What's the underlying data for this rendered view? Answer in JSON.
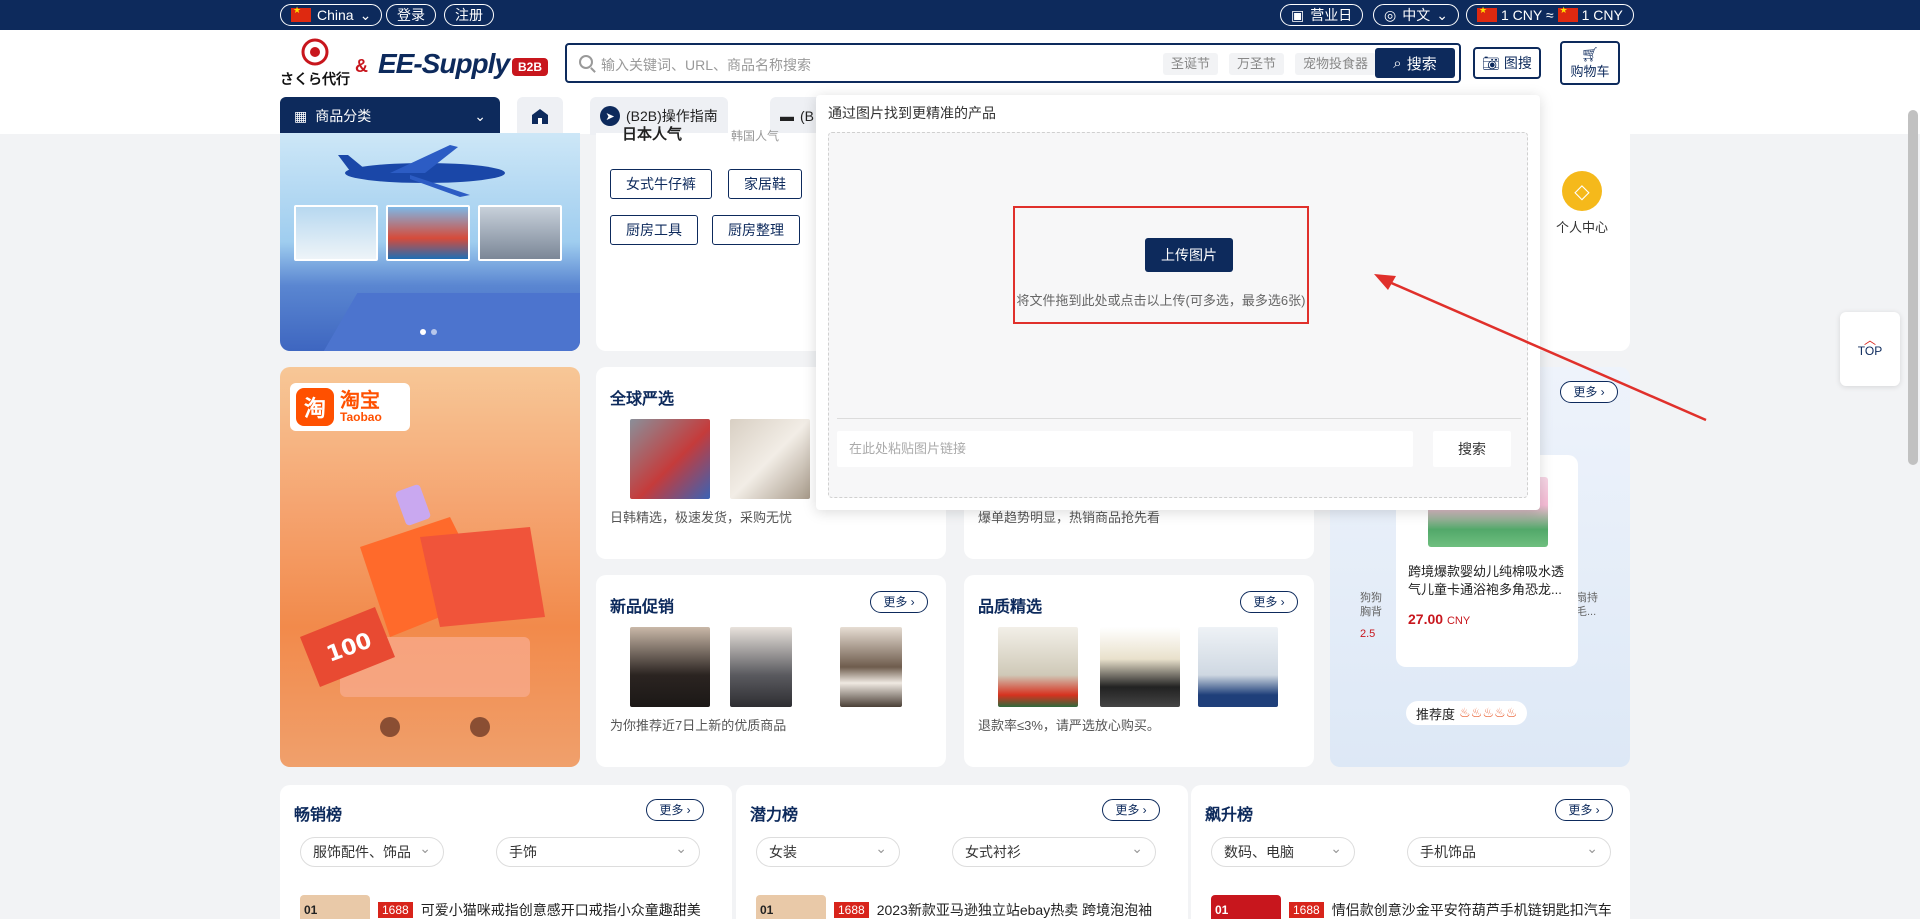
{
  "topbar": {
    "country": "China",
    "login": "登录",
    "register": "注册",
    "business_day": "营业日",
    "language": "中文",
    "currency_left": "1 CNY ≈",
    "currency_right": "1 CNY"
  },
  "header": {
    "sakura_logo": "さくら代行",
    "amp": "&",
    "ee_logo": "EE-Supply",
    "b2b_badge": "B2B",
    "search_placeholder": "输入关键词、URL、商品名称搜索",
    "search_tags": [
      "圣诞节",
      "万圣节",
      "宠物投食器"
    ],
    "search_button": "搜索",
    "image_search": "图搜",
    "cart": "购物车"
  },
  "nav": {
    "category": "商品分类",
    "tab_guide": "(B2B)操作指南",
    "tab_second": "(B"
  },
  "hot": {
    "title": "日本人气",
    "title2": "韩国人气",
    "chips": [
      "女式牛仔裤",
      "家居鞋",
      "厨房工具",
      "厨房整理"
    ],
    "personal_center": "个人中心"
  },
  "taobao": {
    "cn": "淘宝",
    "en": "Taobao",
    "badge": "淘"
  },
  "sections": {
    "global": {
      "title": "全球严选",
      "desc": "日韩精选，极速发货，采购无忧"
    },
    "trend": {
      "desc": "爆单趋势明显，热销商品抢先看"
    },
    "new": {
      "title": "新品促销",
      "more": "更多",
      "desc": "为你推荐近7日上新的优质商品"
    },
    "quality": {
      "title": "品质精选",
      "more": "更多",
      "desc": "退款率≤3%，请严选放心购买。"
    },
    "recommend": {
      "more": "更多",
      "product_title": "跨境爆款婴幼儿纯棉吸水透气儿童卡通浴袍多角恐龙...",
      "price": "27.00",
      "currency": "CNY",
      "rating_label": "推荐度",
      "left_snippet_1": "狗狗",
      "left_snippet_2": "胸背",
      "left_price": "2.5",
      "right_snippet_1": "扇持",
      "right_snippet_2": "毛..."
    }
  },
  "rankings": [
    {
      "title": "畅销榜",
      "more": "更多",
      "dd1": "服饰配件、饰品",
      "dd2": "手饰",
      "num": "01",
      "badge": "1688",
      "item": "可爱小猫咪戒指创意感开口戒指小众童趣甜美"
    },
    {
      "title": "潜力榜",
      "more": "更多",
      "dd1": "女装",
      "dd2": "女式衬衫",
      "num": "01",
      "badge": "1688",
      "item": "2023新款亚马逊独立站ebay热卖 跨境泡泡袖"
    },
    {
      "title": "飙升榜",
      "more": "更多",
      "dd1": "数码、电脑",
      "dd2": "手机饰品",
      "num": "01",
      "badge": "1688",
      "item": "情侣款创意沙金平安符葫芦手机链钥匙扣汽车"
    }
  ],
  "top_button": "TOP",
  "popup": {
    "title": "通过图片找到更精准的产品",
    "upload_button": "上传图片",
    "upload_hint": "将文件拖到此处或点击以上传(可多选，最多选6张)",
    "url_placeholder": "在此处粘贴图片链接",
    "search_button": "搜索"
  },
  "colors": {
    "brand": "#0d2a5c",
    "accent": "#c8161d",
    "annotation": "#e0302b"
  }
}
